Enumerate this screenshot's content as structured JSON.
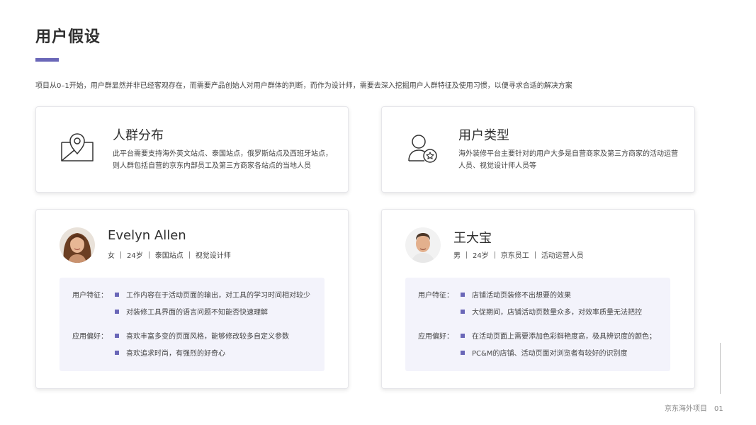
{
  "title": "用户假设",
  "intro": "项目从0–1开始，用户群显然并非已经客观存在，而需要产品创始人对用户群体的判断，而作为设计师，需要去深入挖掘用户人群特征及使用习惯，以便寻求合适的解决方案",
  "accent_color": "#6a67b8",
  "cards": [
    {
      "icon": "map-pin-icon",
      "heading": "人群分布",
      "text": "此平台需要支持海外英文站点、泰国站点，俄罗斯站点及西班牙站点，则人群包括自营的京东内部员工及第三方商家各站点的当地人员"
    },
    {
      "icon": "user-star-icon",
      "heading": "用户类型",
      "text": "海外装修平台主要针对的用户大多是自营商家及第三方商家的活动运营人员、视觉设计师人员等"
    }
  ],
  "personas": [
    {
      "name": "Evelyn Allen",
      "meta": [
        "女",
        "24岁",
        "泰国站点",
        "视觉设计师"
      ],
      "traits_label": "用户特征：",
      "traits": [
        "工作内容在于活动页面的输出，对工具的学习时间相对较少",
        "对装修工具界面的语言问题不知能否快速理解"
      ],
      "prefs_label": "应用偏好：",
      "prefs": [
        "喜欢丰富多变的页面风格，能够修改较多自定义参数",
        "喜欢追求时尚，有强烈的好奇心"
      ]
    },
    {
      "name": "王大宝",
      "meta": [
        "男",
        "24岁",
        "京东员工",
        "活动运营人员"
      ],
      "traits_label": "用户特征：",
      "traits": [
        "店铺活动页装修不出想要的效果",
        "大促期间，店铺活动页数量众多，对效率质量无法把控"
      ],
      "prefs_label": "应用偏好：",
      "prefs": [
        "在活动页面上需要添加色彩鲜艳度高，极具辨识度的颜色；",
        "PC&M的店铺、活动页面对浏览者有较好的识别度"
      ]
    }
  ],
  "footer": {
    "project": "京东海外项目",
    "page": "01"
  }
}
